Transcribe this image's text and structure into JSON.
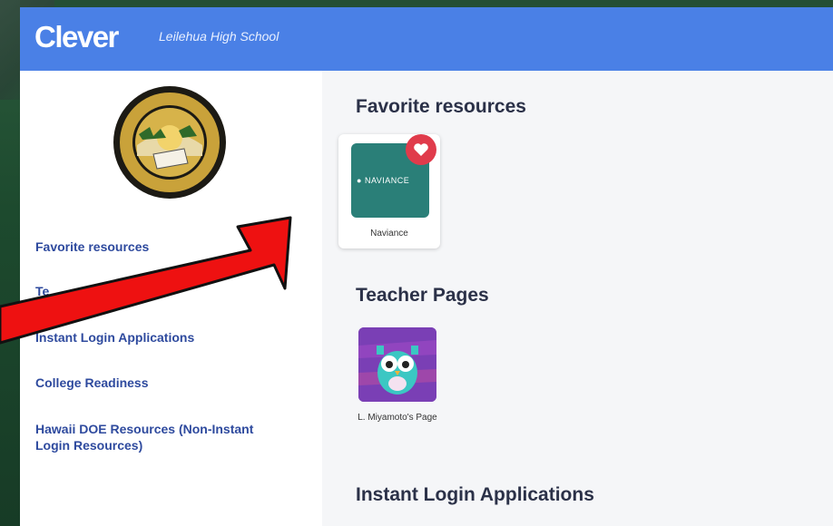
{
  "header": {
    "logo_text": "Clever",
    "school_name": "Leilehua High School"
  },
  "sidebar": {
    "seal_icon": "department-of-education-seal",
    "items": [
      {
        "label": "Favorite resources"
      },
      {
        "label": "Te"
      },
      {
        "label": "Instant Login Applications"
      },
      {
        "label": "College Readiness"
      },
      {
        "label": "Hawaii DOE Resources (Non-Instant Login Resources)"
      }
    ]
  },
  "main": {
    "sections": [
      {
        "title": "Favorite resources",
        "apps": [
          {
            "name": "Naviance",
            "tile_text": "NAVIANCE",
            "favorite_icon": "heart-icon",
            "tile_color": "#2a7f78"
          }
        ]
      },
      {
        "title": "Teacher Pages",
        "apps": [
          {
            "name": "L. Miyamoto's Page",
            "icon": "owl-icon",
            "tile_color": "#7a3fb5"
          }
        ]
      },
      {
        "title": "Instant Login Applications",
        "apps": []
      }
    ]
  },
  "overlay": {
    "arrow_icon": "red-arrow-icon",
    "arrow_color": "#ee1111"
  },
  "colors": {
    "topbar": "#4a80e6",
    "nav_link": "#2e4a9e",
    "heading": "#2b3148"
  }
}
